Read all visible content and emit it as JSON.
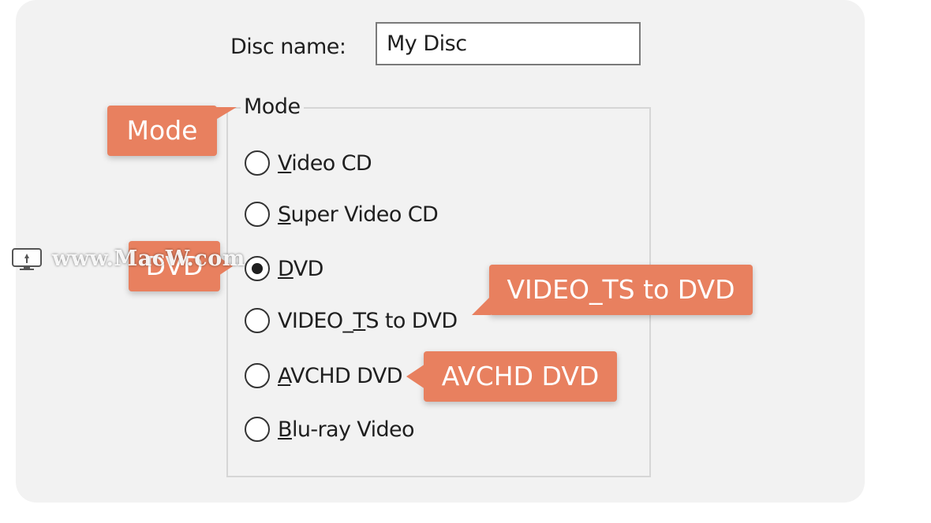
{
  "disc": {
    "label": "Disc name:",
    "value": "My Disc"
  },
  "mode_group": {
    "title": "Mode",
    "options": [
      {
        "pre": "",
        "key": "V",
        "post": "ideo CD",
        "selected": false
      },
      {
        "pre": "",
        "key": "S",
        "post": "uper Video CD",
        "selected": false
      },
      {
        "pre": "",
        "key": "D",
        "post": "VD",
        "selected": true
      },
      {
        "pre": "VIDEO_",
        "key": "T",
        "post": "S to DVD",
        "selected": false
      },
      {
        "pre": "",
        "key": "A",
        "post": "VCHD DVD",
        "selected": false
      },
      {
        "pre": "",
        "key": "B",
        "post": "lu-ray Video",
        "selected": false
      }
    ]
  },
  "callouts": {
    "mode": "Mode",
    "dvd": "DVD",
    "video_ts": "VIDEO_TS to DVD",
    "avchd": "AVCHD DVD",
    "color": "#e8805f"
  },
  "watermark": {
    "text": "www.MacW.com",
    "icon": "monitor-icon"
  }
}
